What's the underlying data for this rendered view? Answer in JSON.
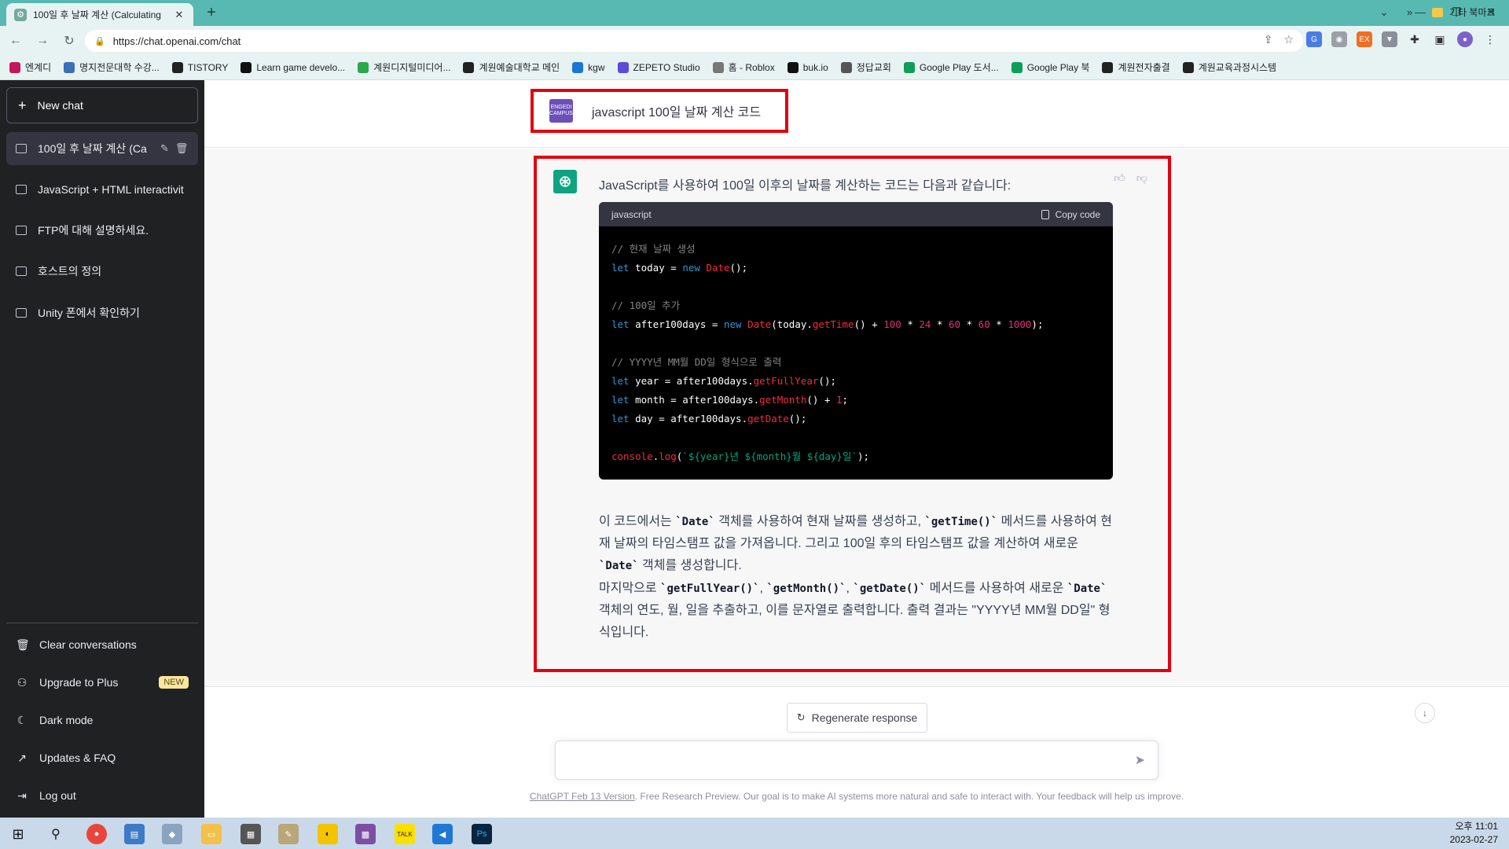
{
  "browser": {
    "tab_title": "100일 후 날짜 계산 (Calculating",
    "url": "https://chat.openai.com/chat",
    "bookmarks": [
      "엔계디",
      "명지전문대학 수강...",
      "TISTORY",
      "Learn game develo...",
      "계원디지털미디어...",
      "계원예술대학교 메인",
      "kgw",
      "ZEPETO Studio",
      "홈 - Roblox",
      "buk.io",
      "정답교회",
      "Google Play 도서...",
      "Google Play 북",
      "계원전자출결",
      "계원교육과정시스템"
    ],
    "bookmarks_more": "»",
    "other_bookmarks": "기타 북마크"
  },
  "sidebar": {
    "new_chat": "New chat",
    "conversations": [
      {
        "label": "100일 후 날짜 계산 (Ca"
      },
      {
        "label": "JavaScript + HTML interactivit"
      },
      {
        "label": "FTP에 대해 설명하세요."
      },
      {
        "label": "호스트의 정의"
      },
      {
        "label": "Unity 폰에서 확인하기"
      }
    ],
    "clear": "Clear conversations",
    "upgrade": "Upgrade to Plus",
    "upgrade_badge": "NEW",
    "dark_mode": "Dark mode",
    "updates": "Updates & FAQ",
    "logout": "Log out"
  },
  "chat": {
    "user_avatar_text": "ENGEDI CAMPUS",
    "user_message": "javascript 100일 날짜 계산 코드",
    "assistant_intro": "JavaScript를 사용하여 100일 이후의 날짜를 계산하는 코드는 다음과 같습니다:",
    "code_lang": "javascript",
    "copy_label": "Copy code",
    "para1": {
      "t1": "이 코드에서는 ",
      "c1": "`Date`",
      "t2": " 객체를 사용하여 현재 날짜를 생성하고, ",
      "c2": "`getTime()`",
      "t3": " 메서드를 사용하여 현재 날짜의 타임스탬프 값을 가져옵니다. 그리고 100일 후의 타임스탬프 값을 계산하여 새로운 ",
      "c3": "`Date`",
      "t4": " 객체를 생성합니다."
    },
    "para2": {
      "t1": "마지막으로 ",
      "c1": "`getFullYear()`",
      "t2": ", ",
      "c2": "`getMonth()`",
      "t3": ", ",
      "c3": "`getDate()`",
      "t4": " 메서드를 사용하여 새로운 ",
      "c4": "`Date`",
      "t5": " 객체의 연도, 월, 일을 추출하고, 이를 문자열로 출력합니다. 출력 결과는 \"YYYY년 MM월 DD일\" 형식입니다."
    }
  },
  "code_lines": [
    [
      [
        "cm",
        "// 현재 날짜 생성"
      ]
    ],
    [
      [
        "kw",
        "let"
      ],
      [
        "",
        " today = "
      ],
      [
        "kw",
        "new"
      ],
      [
        "",
        " "
      ],
      [
        "fn",
        "Date"
      ],
      [
        "",
        "();"
      ]
    ],
    [],
    [
      [
        "cm",
        "// 100일 추가"
      ]
    ],
    [
      [
        "kw",
        "let"
      ],
      [
        "",
        " after100days = "
      ],
      [
        "kw",
        "new"
      ],
      [
        "",
        " "
      ],
      [
        "fn",
        "Date"
      ],
      [
        "",
        "(today."
      ],
      [
        "fn",
        "getTime"
      ],
      [
        "",
        "() + "
      ],
      [
        "num",
        "100"
      ],
      [
        "",
        " * "
      ],
      [
        "num",
        "24"
      ],
      [
        "",
        " * "
      ],
      [
        "num",
        "60"
      ],
      [
        "",
        " * "
      ],
      [
        "num",
        "60"
      ],
      [
        "",
        " * "
      ],
      [
        "num",
        "1000"
      ],
      [
        "",
        ");"
      ]
    ],
    [],
    [
      [
        "cm",
        "// YYYY년 MM월 DD일 형식으로 출력"
      ]
    ],
    [
      [
        "kw",
        "let"
      ],
      [
        "",
        " year = after100days."
      ],
      [
        "fn",
        "getFullYear"
      ],
      [
        "",
        "();"
      ]
    ],
    [
      [
        "kw",
        "let"
      ],
      [
        "",
        " month = after100days."
      ],
      [
        "fn",
        "getMonth"
      ],
      [
        "",
        "() + "
      ],
      [
        "num",
        "1"
      ],
      [
        "",
        ";"
      ]
    ],
    [
      [
        "kw",
        "let"
      ],
      [
        "",
        " day = after100days."
      ],
      [
        "fn",
        "getDate"
      ],
      [
        "",
        "();"
      ]
    ],
    [],
    [
      [
        "fn",
        "console"
      ],
      [
        "",
        "."
      ],
      [
        "fn",
        "log"
      ],
      [
        "",
        "("
      ],
      [
        "str",
        "`${year}년 ${month}월 ${day}일`"
      ],
      [
        "",
        ");"
      ]
    ]
  ],
  "bottom": {
    "regenerate": "Regenerate response",
    "input_placeholder": "",
    "footer_link": "ChatGPT Feb 13 Version",
    "footer_text": ". Free Research Preview. Our goal is to make AI systems more natural and safe to interact with. Your feedback will help us improve."
  },
  "taskbar": {
    "time": "오후 11:01",
    "date": "2023-02-27"
  },
  "colors": {
    "tab_bar": "#58b9b2",
    "sidebar_bg": "#202123",
    "highlight_box": "#e3000f",
    "gpt_green": "#10a37f"
  }
}
